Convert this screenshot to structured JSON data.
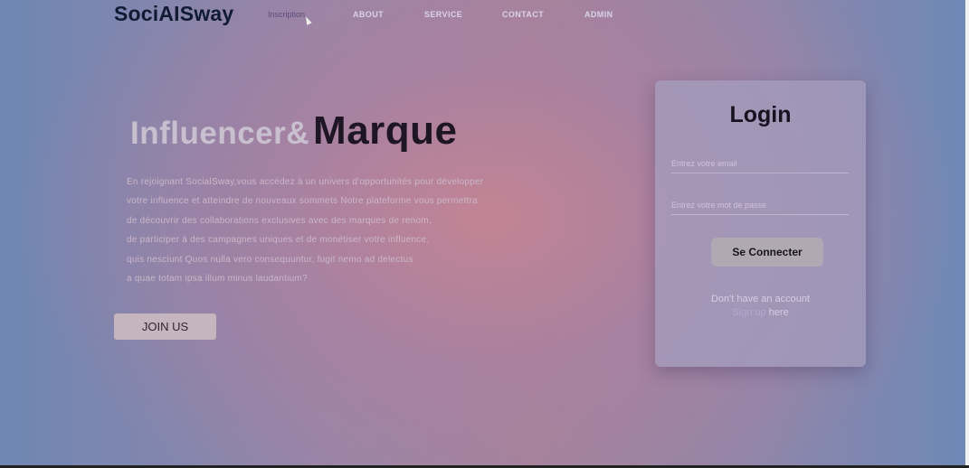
{
  "brand": "SociAISway",
  "nav": {
    "items": [
      "Inscription",
      "ABOUT",
      "SERVICE",
      "CONTACT",
      "ADMIN"
    ]
  },
  "hero": {
    "title_light": "Influencer&",
    "title_dark": "Marque",
    "paragraph_lines": [
      "En rejoignant SocialSway,vous accédez à un univers d'opportunités pour développer",
      "votre influence et atteindre de nouveaux sommets Notre plateforme vous permettra",
      "de découvrir des collaborations exclusives avec des marques de renom,",
      "de participer à des campagnes uniques et de monétiser votre influence.",
      "quis nesciunt  Quos nulla vero consequuntur, fugit nemo ad delectus",
      "a quae totam ipsa illum minus laudantium?"
    ],
    "join_label": "JOIN US"
  },
  "login": {
    "title": "Login",
    "email_placeholder": "Entrez votre email",
    "password_placeholder": "Entrez votre mot de passe",
    "submit_label": "Se Connecter",
    "no_account_text": "Don't have an account",
    "signup_link_label": "Sign up",
    "signup_suffix": " here"
  }
}
